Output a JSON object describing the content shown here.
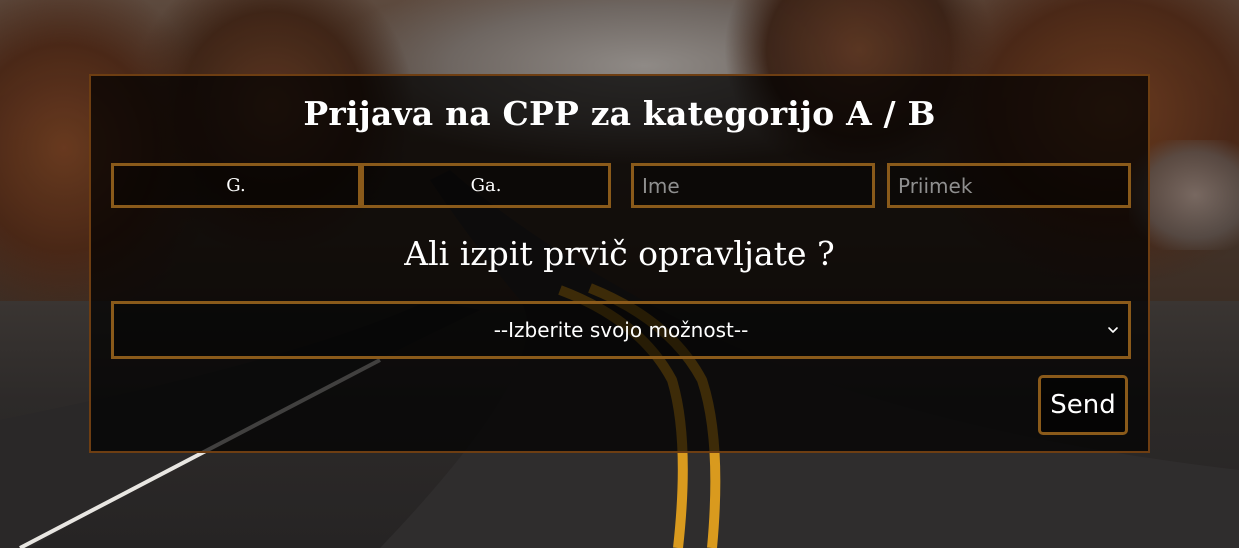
{
  "form": {
    "title": "Prijava na CPP za kategorijo A / B",
    "title_select_1": "G.",
    "title_select_2": "Ga.",
    "first_name_placeholder": "Ime",
    "last_name_placeholder": "Priimek",
    "question": "Ali izpit prvič opravljate ?",
    "dropdown_selected": "--Izberite svojo možnost--",
    "send_label": "Send"
  },
  "icons": {
    "dropdown_arrow": "chevron-down-icon"
  },
  "colors": {
    "panel_border": "#6e3e12",
    "field_border": "#8a5a1a",
    "text": "#ffffff"
  }
}
